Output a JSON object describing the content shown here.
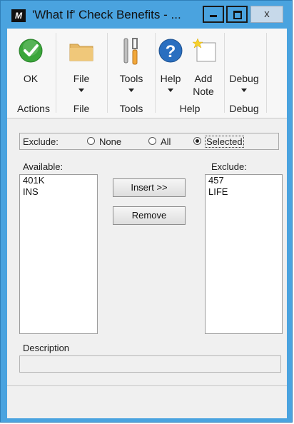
{
  "window": {
    "title": "'What If' Check Benefits  - ...",
    "app_icon_text": "M",
    "close_glyph": "x"
  },
  "ribbon": {
    "buttons": [
      {
        "label": "OK",
        "icon": "checkmark-icon"
      },
      {
        "label": "File",
        "icon": "folder-icon"
      },
      {
        "label": "Tools",
        "icon": "tools-icon"
      },
      {
        "label": "Help",
        "icon": "help-icon"
      },
      {
        "label_line1": "Add",
        "label_line2": "Note",
        "icon": "note-icon"
      },
      {
        "label": "Debug",
        "icon": "none"
      }
    ],
    "groups": [
      "Actions",
      "File",
      "Tools",
      "Help",
      "Debug"
    ]
  },
  "exclude": {
    "label": "Exclude:",
    "options": [
      "None",
      "All",
      "Selected"
    ],
    "selected": "Selected"
  },
  "available": {
    "label": "Available:",
    "items": [
      "401K",
      "INS"
    ]
  },
  "excluded": {
    "label": "Exclude:",
    "items": [
      "457",
      "LIFE"
    ]
  },
  "buttons": {
    "insert": "Insert >>",
    "remove": "Remove"
  },
  "description": {
    "label": "Description",
    "value": ""
  },
  "colors": {
    "title_bar": "#4aa3df",
    "ok_green": "#3aa63a",
    "help_blue": "#2a6fc0"
  }
}
